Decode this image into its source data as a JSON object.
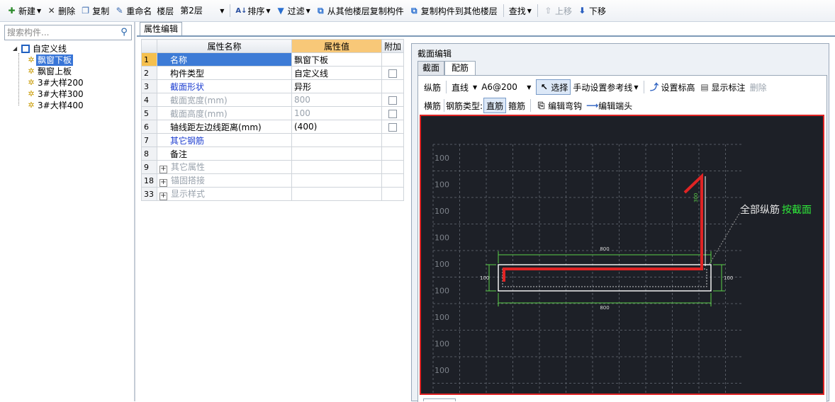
{
  "toolbar": {
    "new": "新建",
    "delete": "删除",
    "copy": "复制",
    "rename": "重命名",
    "floor_label": "楼层",
    "floor_value": "第2层",
    "sort": "排序",
    "filter": "过滤",
    "copy_from_other": "从其他楼层复制构件",
    "copy_to_other": "复制构件到其他楼层",
    "find": "查找",
    "move_up": "上移",
    "move_down": "下移"
  },
  "left": {
    "search_placeholder": "搜索构件...",
    "tree_root": "自定义线",
    "items": [
      "飘窗下板",
      "飘窗上板",
      "3#大样200",
      "3#大样300",
      "3#大样400"
    ]
  },
  "tab_property": "属性编辑",
  "grid": {
    "headers": [
      "属性名称",
      "属性值",
      "附加"
    ],
    "rows": [
      {
        "num": "1",
        "name": "名称",
        "value": "飘窗下板"
      },
      {
        "num": "2",
        "name": "构件类型",
        "value": "自定义线"
      },
      {
        "num": "3",
        "name": "截面形状",
        "value": "异形"
      },
      {
        "num": "4",
        "name": "截面宽度(mm)",
        "value": "800"
      },
      {
        "num": "5",
        "name": "截面高度(mm)",
        "value": "100"
      },
      {
        "num": "6",
        "name": "轴线距左边线距离(mm)",
        "value": "(400)"
      },
      {
        "num": "7",
        "name": "其它钢筋",
        "value": ""
      },
      {
        "num": "8",
        "name": "备注",
        "value": ""
      },
      {
        "num": "9",
        "name": "其它属性",
        "value": ""
      },
      {
        "num": "18",
        "name": "锚固搭接",
        "value": ""
      },
      {
        "num": "33",
        "name": "显示样式",
        "value": ""
      }
    ]
  },
  "section": {
    "title": "截面编辑",
    "tabs": [
      "截面",
      "配筋"
    ],
    "tb_long": "纵筋",
    "tb_line": "直线",
    "tb_spec": "A6@200",
    "tb_select": "选择",
    "tb_ref": "手动设置参考线",
    "tb_elev": "设置标高",
    "tb_show": "显示标注",
    "tb_del": "删除",
    "tb_horiz": "横筋",
    "tb_type_label": "钢筋类型:",
    "tb_straight": "直筋",
    "tb_stirrup": "箍筋",
    "tb_bend": "编辑弯钩",
    "tb_end": "编辑端头"
  },
  "cad": {
    "grid_label": "100",
    "dim_top": "800",
    "dim_bottom": "800",
    "dim_left": "100",
    "dim_right": "100",
    "dim_vertical": "300",
    "annotation_white": "全部纵筋",
    "annotation_green": "按截面",
    "colors": {
      "background": "#1d2027",
      "rebar": "#e02424",
      "dimension": "#5ad04a",
      "outline": "#ffffff",
      "annotation_green": "#2fe83a"
    }
  }
}
